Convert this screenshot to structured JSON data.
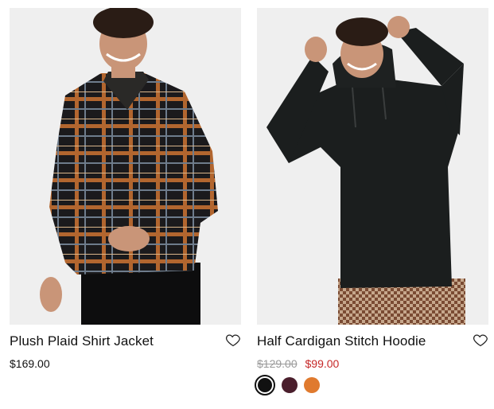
{
  "products": [
    {
      "title": "Plush Plaid Shirt Jacket",
      "price": "$169.00",
      "image_alt": "Model wearing plaid fleece shirt jacket"
    },
    {
      "title": "Half Cardigan Stitch Hoodie",
      "original_price": "$129.00",
      "sale_price": "$99.00",
      "image_alt": "Model wearing black knit hoodie",
      "swatches": [
        {
          "name": "Black",
          "color": "#111111",
          "selected": true
        },
        {
          "name": "Burgundy",
          "color": "#4a1e2c",
          "selected": false
        },
        {
          "name": "Orange",
          "color": "#e07a2e",
          "selected": false
        }
      ]
    }
  ],
  "icons": {
    "wishlist": "heart-outline-icon"
  }
}
